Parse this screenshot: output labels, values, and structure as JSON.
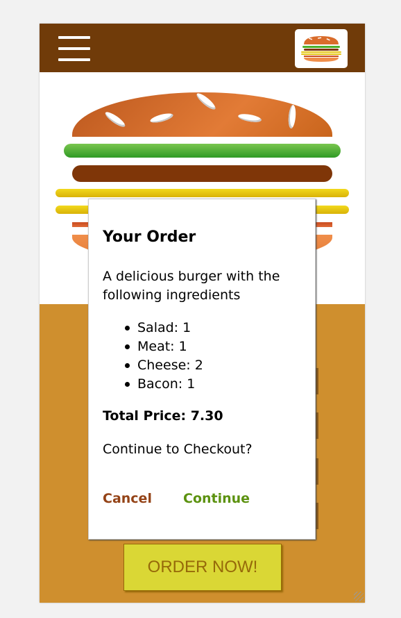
{
  "toolbar": {
    "menu_icon": "hamburger-menu-icon",
    "logo_icon": "burger-logo-icon",
    "background_color": "#703b09"
  },
  "controls": {
    "order_button_label": "ORDER NOW!",
    "background_color": "#cf8f2e"
  },
  "modal": {
    "title": "Your Order",
    "description": "A delicious burger with the following ingredients",
    "ingredients": [
      "Salad: 1",
      "Meat: 1",
      "Cheese: 2",
      "Bacon: 1"
    ],
    "total_label": "Total Price: 7.30",
    "question": "Continue to Checkout?",
    "cancel_label": "Cancel",
    "continue_label": "Continue",
    "cancel_color": "#944317",
    "continue_color": "#5c9210"
  }
}
